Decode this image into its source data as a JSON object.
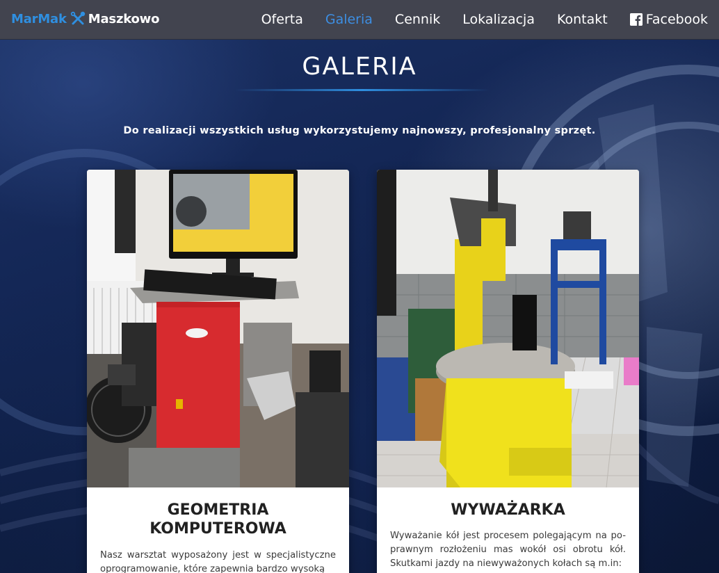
{
  "brand": {
    "part1": "MarMak",
    "part2": "Maszkowo",
    "icon": "wrench-screwdriver-icon",
    "accent": "#2f8fe0"
  },
  "nav": {
    "items": [
      {
        "label": "Oferta",
        "active": false
      },
      {
        "label": "Galeria",
        "active": true
      },
      {
        "label": "Cennik",
        "active": false
      },
      {
        "label": "Lokalizacja",
        "active": false
      },
      {
        "label": "Kontakt",
        "active": false
      },
      {
        "label": "Facebook",
        "active": false,
        "icon": "facebook-icon"
      }
    ]
  },
  "section": {
    "title": "GALERIA",
    "subtitle": "Do realizacji wszystkich usług wykorzystujemy najnowszy, profesjonalny sprzęt."
  },
  "cards": [
    {
      "title_line1": "GEOMETRIA",
      "title_line2": "KOMPUTEROWA",
      "text": "Nasz warsztat wyposażony jest w specjalistyczne oprogramowanie, które zapewnia bardzo wysoką",
      "image": "wheel-alignment-machine-photo"
    },
    {
      "title_line1": "WYWAŻARKA",
      "text": "Wyważanie kół jest procesem polegającym na po-prawnym rozłożeniu mas wokół osi obrotu kół. Skutkami jazdy na niewyważonych kołach są m.in:",
      "image": "tire-changer-machine-photo"
    }
  ]
}
